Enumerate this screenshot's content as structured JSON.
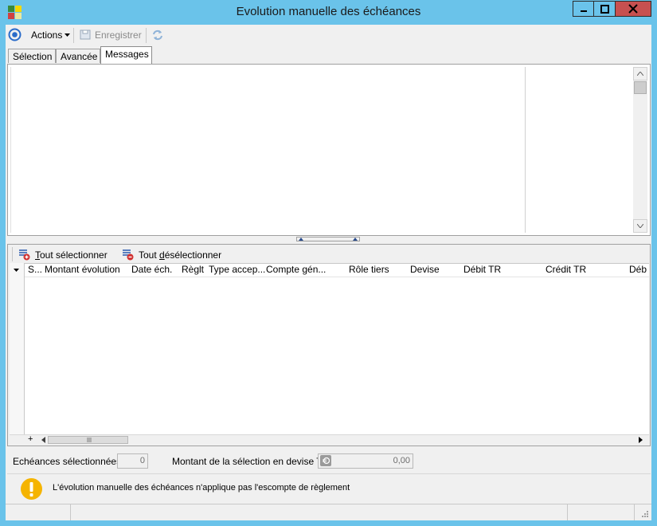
{
  "window": {
    "title": "Evolution manuelle des échéances",
    "minimize_icon": "minimize-icon",
    "maximize_icon": "maximize-icon",
    "close_icon": "close-icon",
    "close_color": "#c75050",
    "frame_color": "#6ac3ea"
  },
  "toolbar": {
    "actions_label": "Actions",
    "save_label": "Enregistrer"
  },
  "tabs": [
    {
      "label": "Sélection"
    },
    {
      "label": "Avancée"
    },
    {
      "label": "Messages"
    }
  ],
  "grid_toolbar": {
    "select_all_label_first": "T",
    "select_all_label_rest": "out sélectionner",
    "deselect_all_label_prefix": "Tout ",
    "deselect_all_label_accel": "d",
    "deselect_all_label_rest": "ésélectionner"
  },
  "grid": {
    "columns": [
      "S...",
      "Montant évolution",
      "Date éch.",
      "Règlt",
      "Type accep...",
      "Compte gén...",
      "Rôle tiers",
      "Devise",
      "Débit TR",
      "Crédit TR",
      "Déb"
    ],
    "add_label": "+"
  },
  "summary": {
    "selected_label": "Echéances sélectionnées",
    "selected_value": "0",
    "amount_label": "Montant de la sélection en devise TC",
    "amount_value": "0,00"
  },
  "notice": {
    "text": "L'évolution manuelle des échéances n'applique pas l'escompte de règlement",
    "icon_color": "#f5b400"
  }
}
